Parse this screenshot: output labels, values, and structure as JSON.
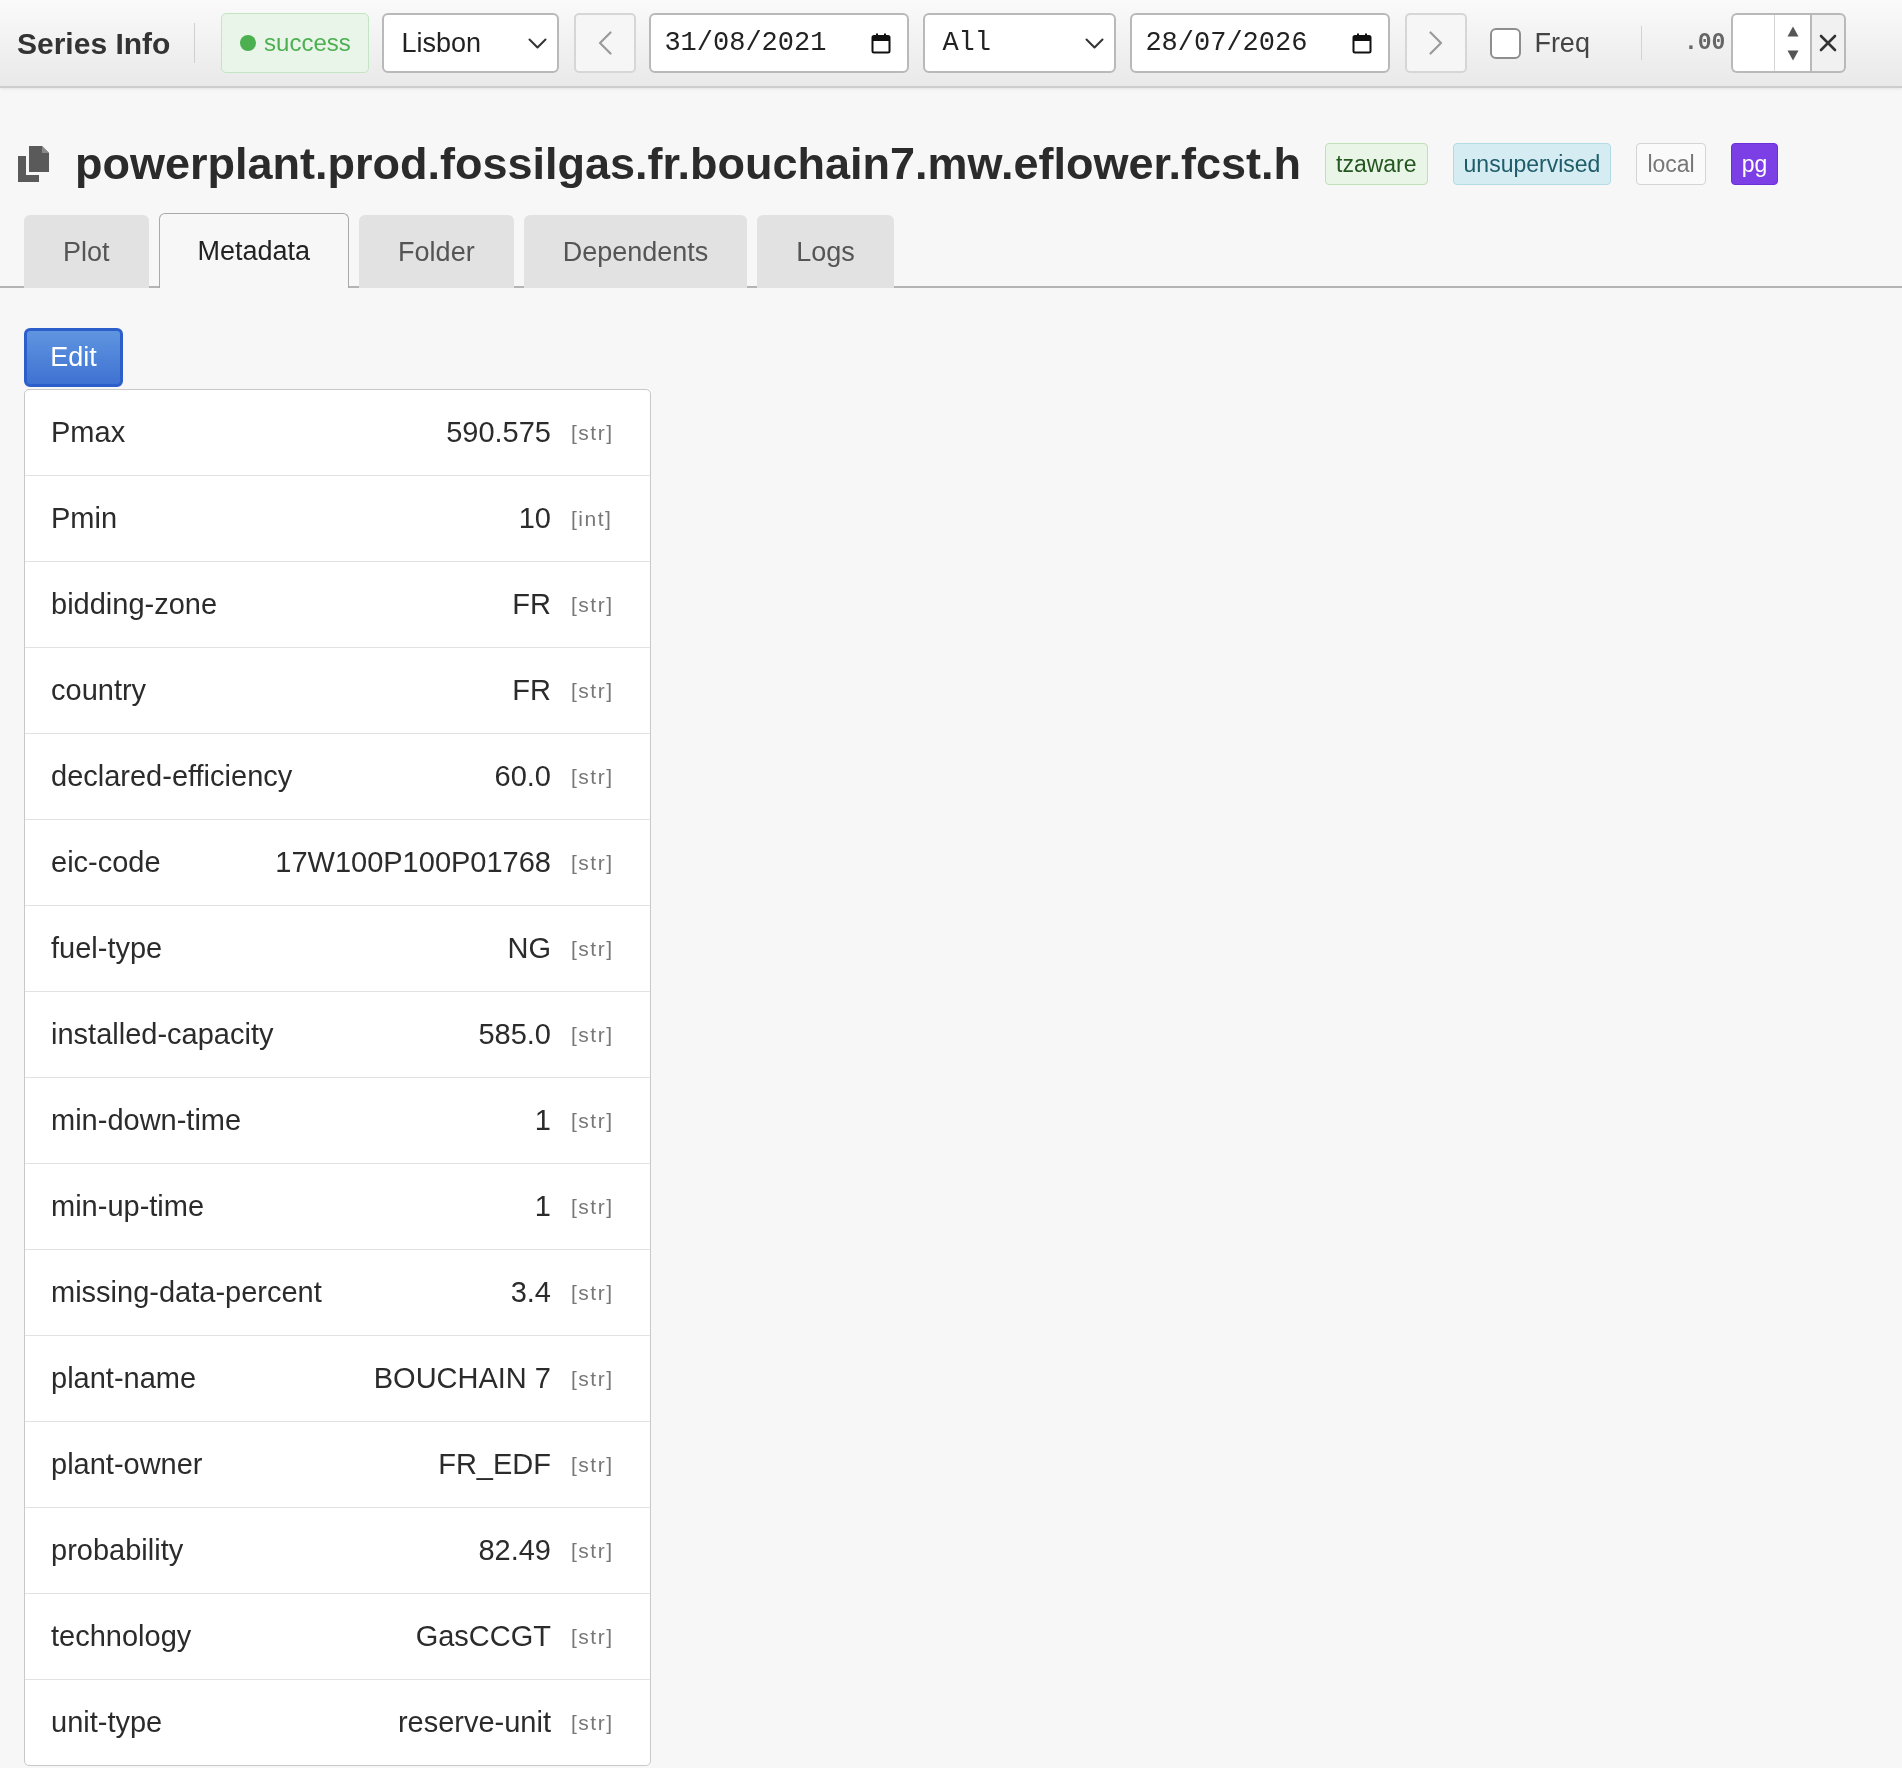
{
  "toolbar": {
    "title": "Series Info",
    "status": {
      "text": "success",
      "kind": "success"
    },
    "timezone": {
      "value": "Lisbon"
    },
    "from_date": {
      "value": "31/08/2021"
    },
    "horizon": {
      "value": "All"
    },
    "to_date": {
      "value": "28/07/2026"
    },
    "freq": {
      "label": "Freq",
      "checked": false
    },
    "decimals": {
      "label": ".00"
    }
  },
  "series": {
    "name": "powerplant.prod.fossilgas.fr.bouchain7.mw.eflower.fcst.h",
    "badges": [
      {
        "text": "tzaware",
        "kind": "success"
      },
      {
        "text": "unsupervised",
        "kind": "info"
      },
      {
        "text": "local",
        "kind": "plain"
      },
      {
        "text": "pg",
        "kind": "accent"
      }
    ]
  },
  "tabs": [
    {
      "label": "Plot",
      "selected": false
    },
    {
      "label": "Metadata",
      "selected": true
    },
    {
      "label": "Folder",
      "selected": false
    },
    {
      "label": "Dependents",
      "selected": false
    },
    {
      "label": "Logs",
      "selected": false
    }
  ],
  "edit_button": {
    "label": "Edit"
  },
  "metadata": [
    {
      "key": "Pmax",
      "value": "590.575",
      "type": "[str]"
    },
    {
      "key": "Pmin",
      "value": "10",
      "type": "[int]"
    },
    {
      "key": "bidding-zone",
      "value": "FR",
      "type": "[str]"
    },
    {
      "key": "country",
      "value": "FR",
      "type": "[str]"
    },
    {
      "key": "declared-efficiency",
      "value": "60.0",
      "type": "[str]"
    },
    {
      "key": "eic-code",
      "value": "17W100P100P01768",
      "type": "[str]"
    },
    {
      "key": "fuel-type",
      "value": "NG",
      "type": "[str]"
    },
    {
      "key": "installed-capacity",
      "value": "585.0",
      "type": "[str]"
    },
    {
      "key": "min-down-time",
      "value": "1",
      "type": "[str]"
    },
    {
      "key": "min-up-time",
      "value": "1",
      "type": "[str]"
    },
    {
      "key": "missing-data-percent",
      "value": "3.4",
      "type": "[str]"
    },
    {
      "key": "plant-name",
      "value": "BOUCHAIN 7",
      "type": "[str]"
    },
    {
      "key": "plant-owner",
      "value": "FR_EDF",
      "type": "[str]"
    },
    {
      "key": "probability",
      "value": "82.49",
      "type": "[str]"
    },
    {
      "key": "technology",
      "value": "GasCCGT",
      "type": "[str]"
    },
    {
      "key": "unit-type",
      "value": "reserve-unit",
      "type": "[str]"
    }
  ]
}
